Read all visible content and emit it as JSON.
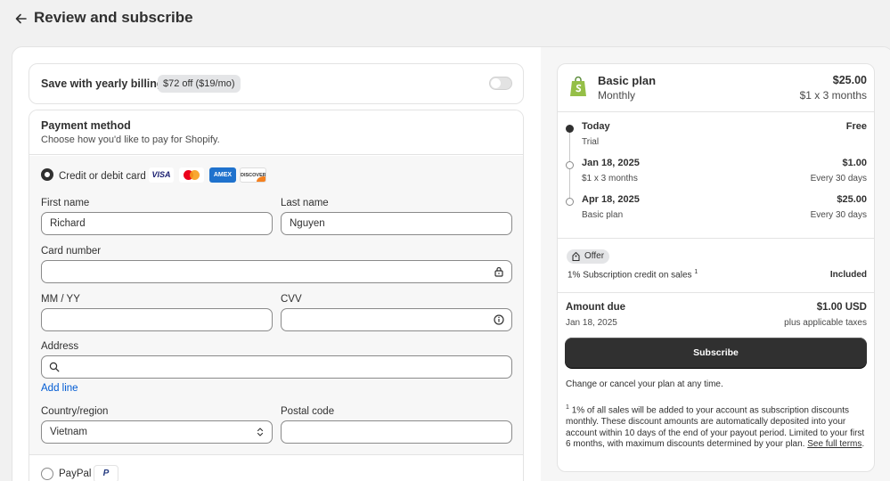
{
  "header": {
    "title": "Review and subscribe"
  },
  "yearly": {
    "label": "Save with yearly billing",
    "badge": "$72 off ($19/mo)"
  },
  "payment": {
    "title": "Payment method",
    "subtitle": "Choose how you'd like to pay for Shopify.",
    "card_option": "Credit or debit card",
    "brands": {
      "visa": "VISA",
      "amex": "AMEX",
      "discover": "DISCOVER"
    },
    "first_name_label": "First name",
    "first_name_value": "Richard",
    "last_name_label": "Last name",
    "last_name_value": "Nguyen",
    "card_number_label": "Card number",
    "expiry_label": "MM / YY",
    "cvv_label": "CVV",
    "address_label": "Address",
    "add_line": "Add line",
    "country_label": "Country/region",
    "country_value": "Vietnam",
    "postal_label": "Postal code",
    "paypal_option": "PayPal",
    "paypal_logo": "P"
  },
  "summary": {
    "plan_name": "Basic plan",
    "plan_cycle": "Monthly",
    "plan_price": "$25.00",
    "plan_trial": "$1 x 3 months",
    "timeline": [
      {
        "date": "Today",
        "sub": "Trial",
        "amount": "Free",
        "freq": ""
      },
      {
        "date": "Jan 18, 2025",
        "sub": "$1 x 3 months",
        "amount": "$1.00",
        "freq": "Every 30 days"
      },
      {
        "date": "Apr 18, 2025",
        "sub": "Basic plan",
        "amount": "$25.00",
        "freq": "Every 30 days"
      }
    ],
    "offer_badge": "Offer",
    "offer_text": "1% Subscription credit on sales",
    "offer_sup": "1",
    "offer_included": "Included",
    "due_label": "Amount due",
    "due_date": "Jan 18, 2025",
    "due_amount": "$1.00 USD",
    "due_taxes": "plus applicable taxes",
    "subscribe": "Subscribe",
    "change_note": "Change or cancel your plan at any time.",
    "footnote_sup": "1",
    "footnote": "1% of all sales will be added to your account as subscription discounts monthly. These discount amounts are automatically deposited into your account within 10 days of the end of your payout period. Limited to your first 6 months, with maximum discounts determined by your plan.",
    "see_terms": "See full terms"
  }
}
